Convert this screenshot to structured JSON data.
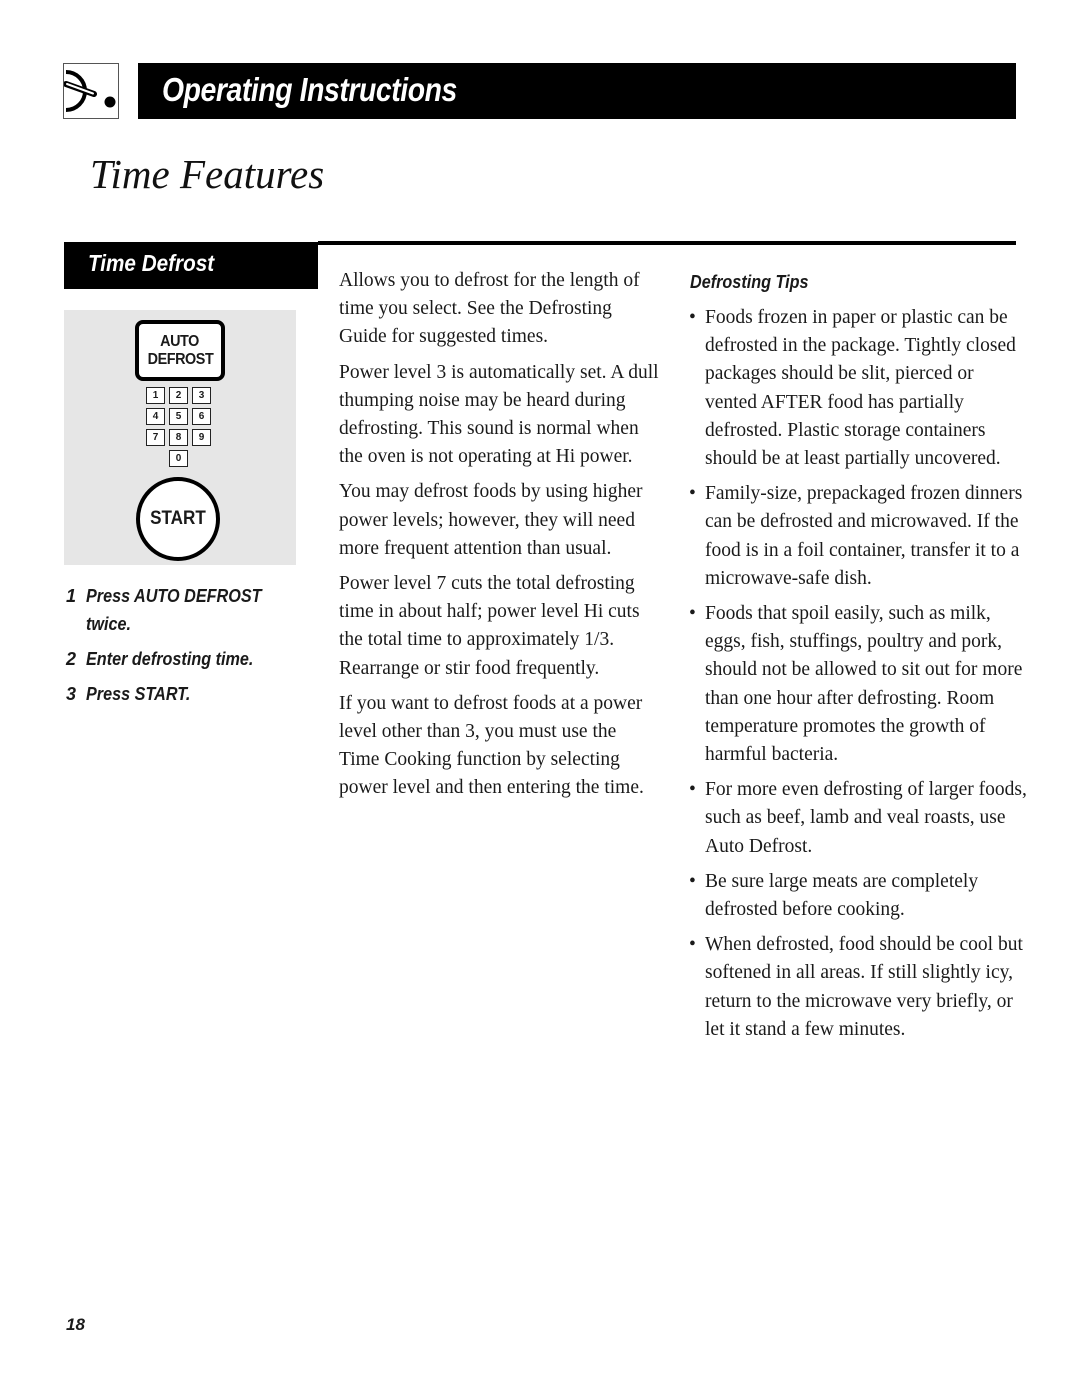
{
  "header": {
    "icon": "dial-knob-icon",
    "title": "Operating Instructions"
  },
  "page_title": "Time Features",
  "section": {
    "title": "Time Defrost"
  },
  "control_panel": {
    "auto_defrost_label_line1": "AUTO",
    "auto_defrost_label_line2": "DEFROST",
    "keys": [
      "1",
      "2",
      "3",
      "4",
      "5",
      "6",
      "7",
      "8",
      "9",
      "0"
    ],
    "start_label": "START"
  },
  "steps": [
    {
      "num": "1",
      "text": "Press AUTO DEFROST twice."
    },
    {
      "num": "2",
      "text": "Enter defrosting time."
    },
    {
      "num": "3",
      "text": "Press START."
    }
  ],
  "description": [
    "Allows you to defrost for the length of time you select. See the Defrosting Guide for suggested times.",
    "Power level 3 is automatically set. A dull thumping noise may be heard during defrosting. This sound is normal when the oven is not operating at Hi power.",
    "You may defrost foods by using higher power levels; however, they will need more frequent attention than usual.",
    "Power level 7 cuts the total defrosting time in about half; power level Hi cuts the total time to approximately 1/3. Rearrange or stir food frequently.",
    "If you want to defrost foods at a power level other than 3, you must use the Time Cooking function by selecting power level and then entering the time."
  ],
  "tips": {
    "heading": "Defrosting Tips",
    "bullet": "•",
    "items": [
      "Foods frozen in paper or plastic can be defrosted in the package. Tightly closed packages should be slit, pierced or vented AFTER food has partially defrosted. Plastic storage containers should be at least partially uncovered.",
      "Family-size, prepackaged frozen dinners can be defrosted and microwaved. If the food is in a foil container, transfer it to a microwave-safe dish.",
      "Foods that spoil easily, such as milk, eggs, fish, stuffings, poultry and pork, should not be allowed to sit out for more than one hour after defrosting. Room temperature promotes the growth of harmful bacteria.",
      "For more even defrosting of larger foods, such as beef, lamb and veal roasts, use Auto Defrost.",
      "Be sure large meats are completely defrosted before cooking.",
      "When defrosted, food should be cool but softened in all areas. If still slightly icy, return to the microwave very briefly, or let it stand a few minutes."
    ]
  },
  "page_number": "18"
}
